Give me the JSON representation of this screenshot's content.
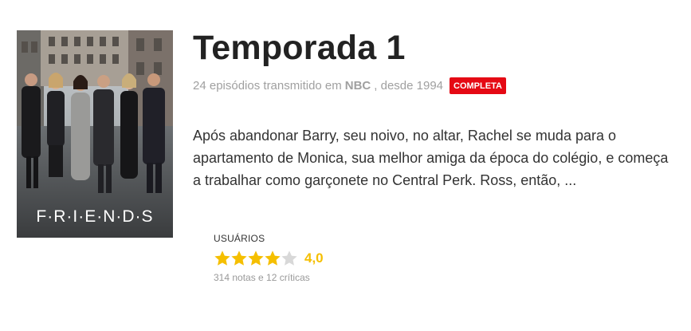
{
  "show": {
    "season_title": "Temporada 1",
    "episodes_text": "24 episódios transmitido em",
    "network": "NBC",
    "since_text": ", desde 1994",
    "status_badge": "COMPLETA",
    "poster_logo_text": "F·R·I·E·N·D·S",
    "synopsis": "Após abandonar Barry, seu noivo, no altar, Rachel se muda para o apartamento de Monica, sua melhor amiga da época do colégio, e começa a trabalhar como garçonete no Central Perk. Ross, então, ..."
  },
  "rating": {
    "label": "USUÁRIOS",
    "score": "4,0",
    "stars_filled": 4,
    "stars_total": 5,
    "counts": "314 notas e 12 críticas",
    "star_color": "#f5bf00",
    "star_empty_color": "#d8d8d8"
  },
  "colors": {
    "badge": "#e50914",
    "title": "#222222"
  }
}
